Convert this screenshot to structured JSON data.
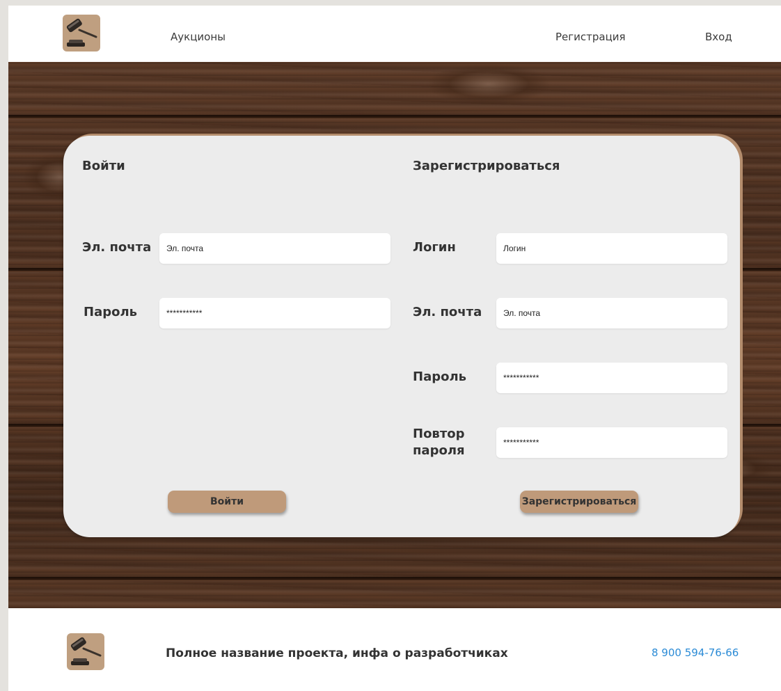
{
  "header": {
    "logo_icon": "gavel-icon",
    "nav": {
      "auctions": "Аукционы",
      "register": "Регистрация",
      "login": "Вход"
    }
  },
  "login_form": {
    "title": "Войти",
    "email_label": "Эл. почта",
    "email_placeholder": "Эл. почта",
    "password_label": "Пароль",
    "password_value": "***********",
    "submit_label": "Войти"
  },
  "register_form": {
    "title": "Зарегистрироваться",
    "login_label": "Логин",
    "login_placeholder": "Логин",
    "email_label": "Эл. почта",
    "email_placeholder": "Эл. почта",
    "password_label": "Пароль",
    "password_value": "***********",
    "repeat_label_line1": "Повтор",
    "repeat_label_line2": "пароля",
    "repeat_value": "***********",
    "submit_label": "Зарегистрироваться"
  },
  "footer": {
    "logo_icon": "gavel-icon",
    "text": "Полное название проекта, инфа о разработчиках",
    "phone": "8 900 594-76-66"
  },
  "colors": {
    "accent": "#bf9a7a",
    "card": "#ececec",
    "link": "#2b8bd6",
    "wood": "#4a2f20"
  }
}
